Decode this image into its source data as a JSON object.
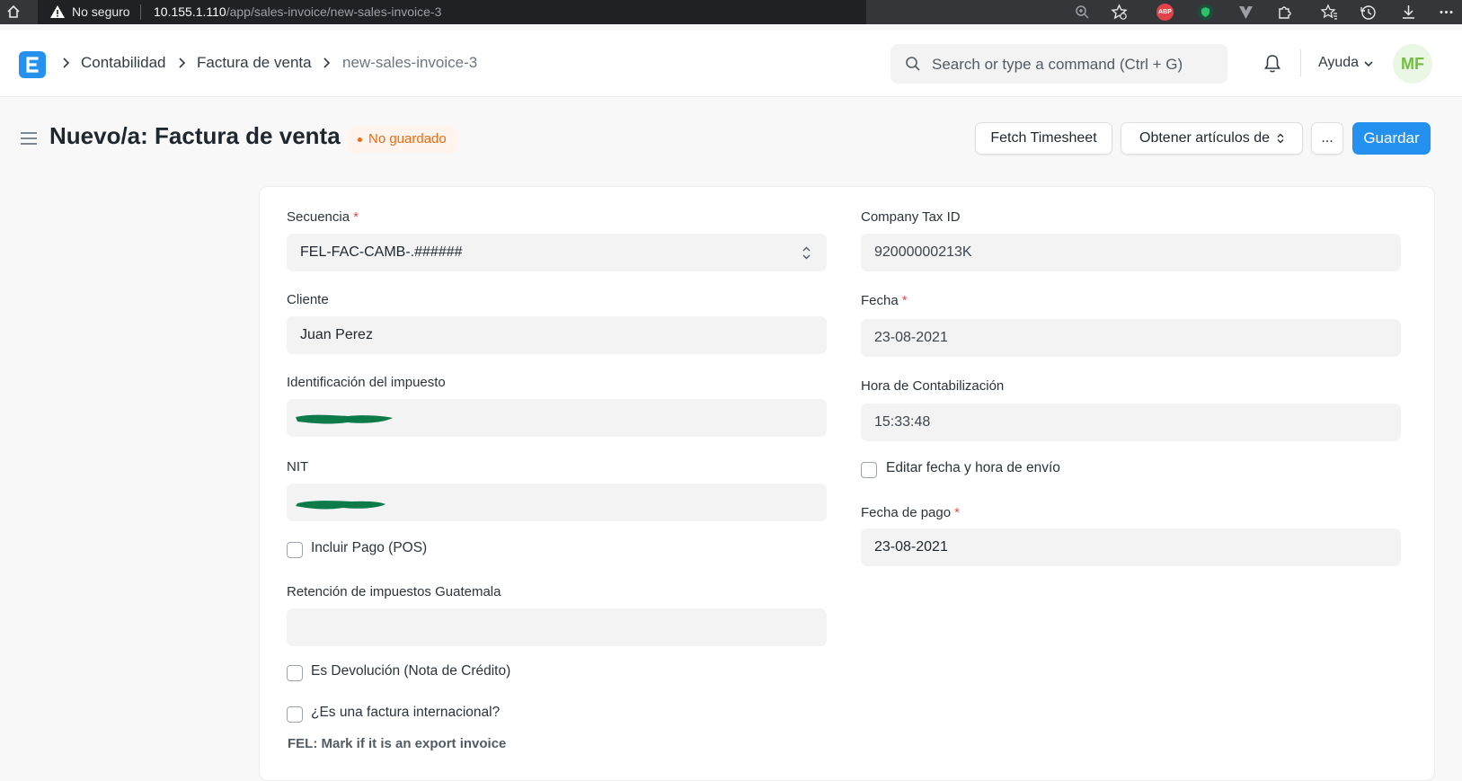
{
  "browser": {
    "security_label": "No seguro",
    "url_host": "10.155.1.110",
    "url_path": "/app/sales-invoice/new-sales-invoice-3",
    "extension_abp": "ABP"
  },
  "navbar": {
    "breadcrumbs": [
      "Contabilidad",
      "Factura de venta",
      "new-sales-invoice-3"
    ],
    "search_placeholder": "Search or type a command (Ctrl + G)",
    "help_label": "Ayuda",
    "avatar_initials": "MF"
  },
  "page": {
    "title": "Nuevo/a: Factura de venta",
    "status": "No guardado",
    "buttons": {
      "fetch_timesheet": "Fetch Timesheet",
      "get_items_from": "Obtener artículos de",
      "more": "...",
      "save": "Guardar"
    }
  },
  "form": {
    "left": {
      "secuencia_label": "Secuencia",
      "secuencia_value": "FEL-FAC-CAMB-.######",
      "cliente_label": "Cliente",
      "cliente_value": "Juan Perez",
      "tax_id_label": "Identificación del impuesto",
      "nit_label": "NIT",
      "incluir_pago_label": "Incluir Pago (POS)",
      "retencion_label": "Retención de impuestos Guatemala",
      "retencion_value": "",
      "es_devolucion_label": "Es Devolución (Nota de Crédito)",
      "internacional_label": "¿Es una factura internacional?",
      "fel_note": "FEL: Mark if it is an export invoice"
    },
    "right": {
      "company_tax_id_label": "Company Tax ID",
      "company_tax_id_value": "92000000213K",
      "fecha_label": "Fecha",
      "fecha_value": "23-08-2021",
      "hora_label": "Hora de Contabilización",
      "hora_value": "15:33:48",
      "editar_fecha_label": "Editar fecha y hora de envío",
      "fecha_pago_label": "Fecha de pago",
      "fecha_pago_value": "23-08-2021"
    },
    "required_mark": "*"
  },
  "colors": {
    "primary": "#2490ef",
    "status_orange": "#e86c13",
    "avatar_green": "#72bf3f",
    "redaction_green": "#0d7a4a"
  }
}
